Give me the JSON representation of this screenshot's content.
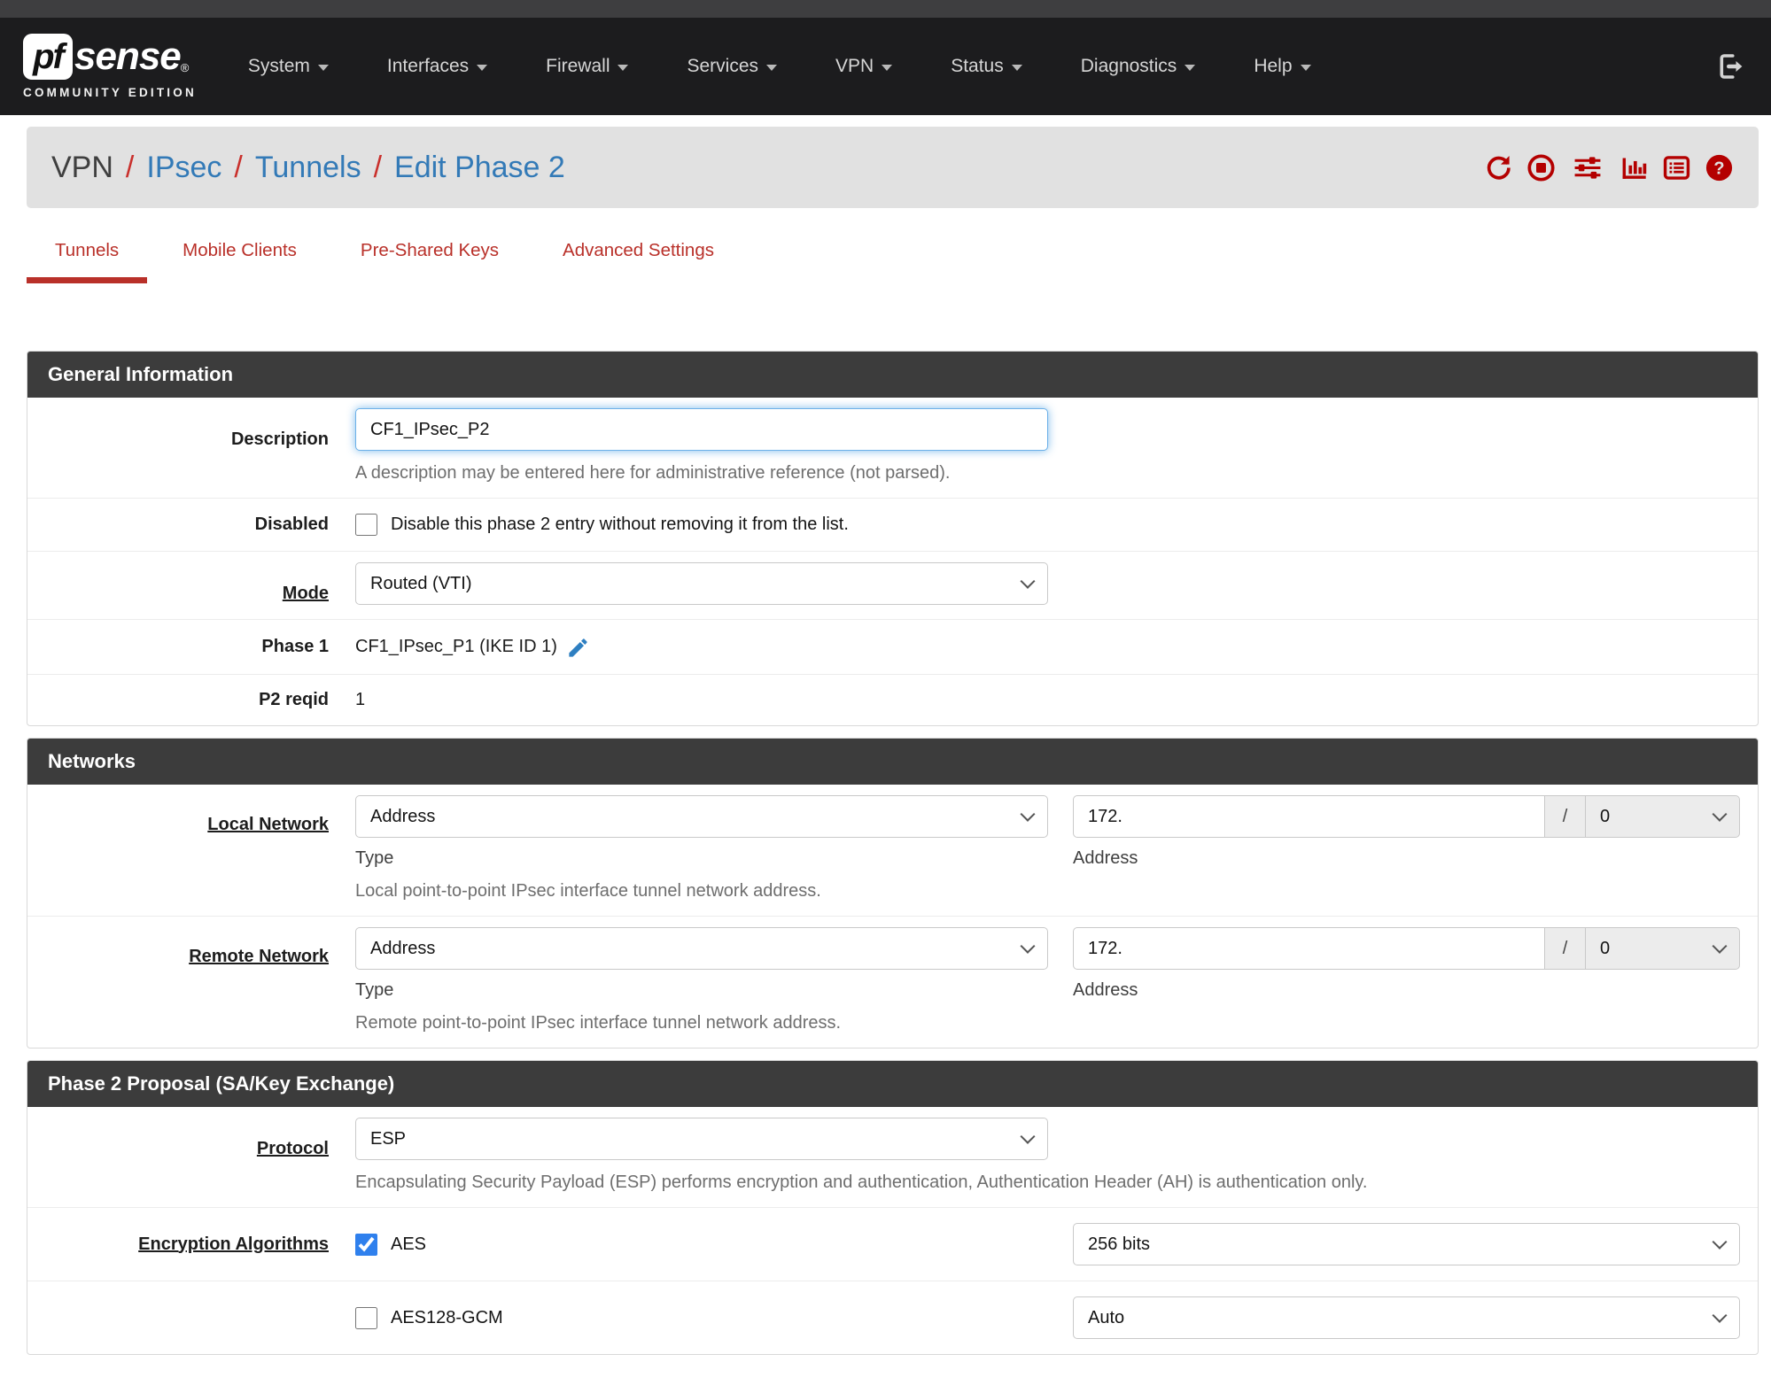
{
  "navbar": {
    "logo": {
      "pf": "pf",
      "sense": "sense",
      "registered": "®",
      "subtitle": "COMMUNITY EDITION"
    },
    "items": [
      {
        "label": "System"
      },
      {
        "label": "Interfaces"
      },
      {
        "label": "Firewall"
      },
      {
        "label": "Services"
      },
      {
        "label": "VPN"
      },
      {
        "label": "Status"
      },
      {
        "label": "Diagnostics"
      },
      {
        "label": "Help"
      }
    ],
    "logout_icon": "sign-out-icon"
  },
  "breadcrumb": {
    "root": "VPN",
    "separator": "/",
    "links": [
      "IPsec",
      "Tunnels",
      "Edit Phase 2"
    ],
    "action_icons": [
      "service-restart-icon",
      "service-stop-icon",
      "related-settings-icon",
      "status-icon",
      "log-icon",
      "help-icon"
    ]
  },
  "tabs": [
    {
      "label": "Tunnels",
      "active": true
    },
    {
      "label": "Mobile Clients",
      "active": false
    },
    {
      "label": "Pre-Shared Keys",
      "active": false
    },
    {
      "label": "Advanced Settings",
      "active": false
    }
  ],
  "general": {
    "title": "General Information",
    "description": {
      "label": "Description",
      "value": "CF1_IPsec_P2",
      "help": "A description may be entered here for administrative reference (not parsed)."
    },
    "disabled": {
      "label": "Disabled",
      "checkbox_label": "Disable this phase 2 entry without removing it from the list.",
      "checked": false
    },
    "mode": {
      "label": "Mode",
      "value": "Routed (VTI)"
    },
    "phase1": {
      "label": "Phase 1",
      "value": "CF1_IPsec_P1 (IKE ID 1)",
      "edit_icon": "pencil-icon"
    },
    "p2reqid": {
      "label": "P2 reqid",
      "value": "1"
    }
  },
  "networks": {
    "title": "Networks",
    "local": {
      "label": "Local Network",
      "type_value": "Address",
      "type_sub": "Type",
      "address_value": "172.",
      "address_sub": "Address",
      "slash": "/",
      "prefix_value": "0",
      "help": "Local point-to-point IPsec interface tunnel network address."
    },
    "remote": {
      "label": "Remote Network",
      "type_value": "Address",
      "type_sub": "Type",
      "address_value": "172.",
      "address_sub": "Address",
      "slash": "/",
      "prefix_value": "0",
      "help": "Remote point-to-point IPsec interface tunnel network address."
    }
  },
  "proposal": {
    "title": "Phase 2 Proposal (SA/Key Exchange)",
    "protocol": {
      "label": "Protocol",
      "value": "ESP",
      "help": "Encapsulating Security Payload (ESP) performs encryption and authentication, Authentication Header (AH) is authentication only."
    },
    "encryption": {
      "label": "Encryption Algorithms",
      "rows": [
        {
          "name": "AES",
          "checked": true,
          "bits": "256 bits"
        },
        {
          "name": "AES128-GCM",
          "checked": false,
          "bits": "Auto"
        }
      ]
    }
  },
  "colors": {
    "brand_red": "#b93029",
    "icon_red": "#b40000",
    "link_blue": "#337ab7",
    "panel_header_bg": "#3c3c3c",
    "checkbox_accent": "#2f80ed",
    "focus_ring": "#6cb0e8"
  }
}
